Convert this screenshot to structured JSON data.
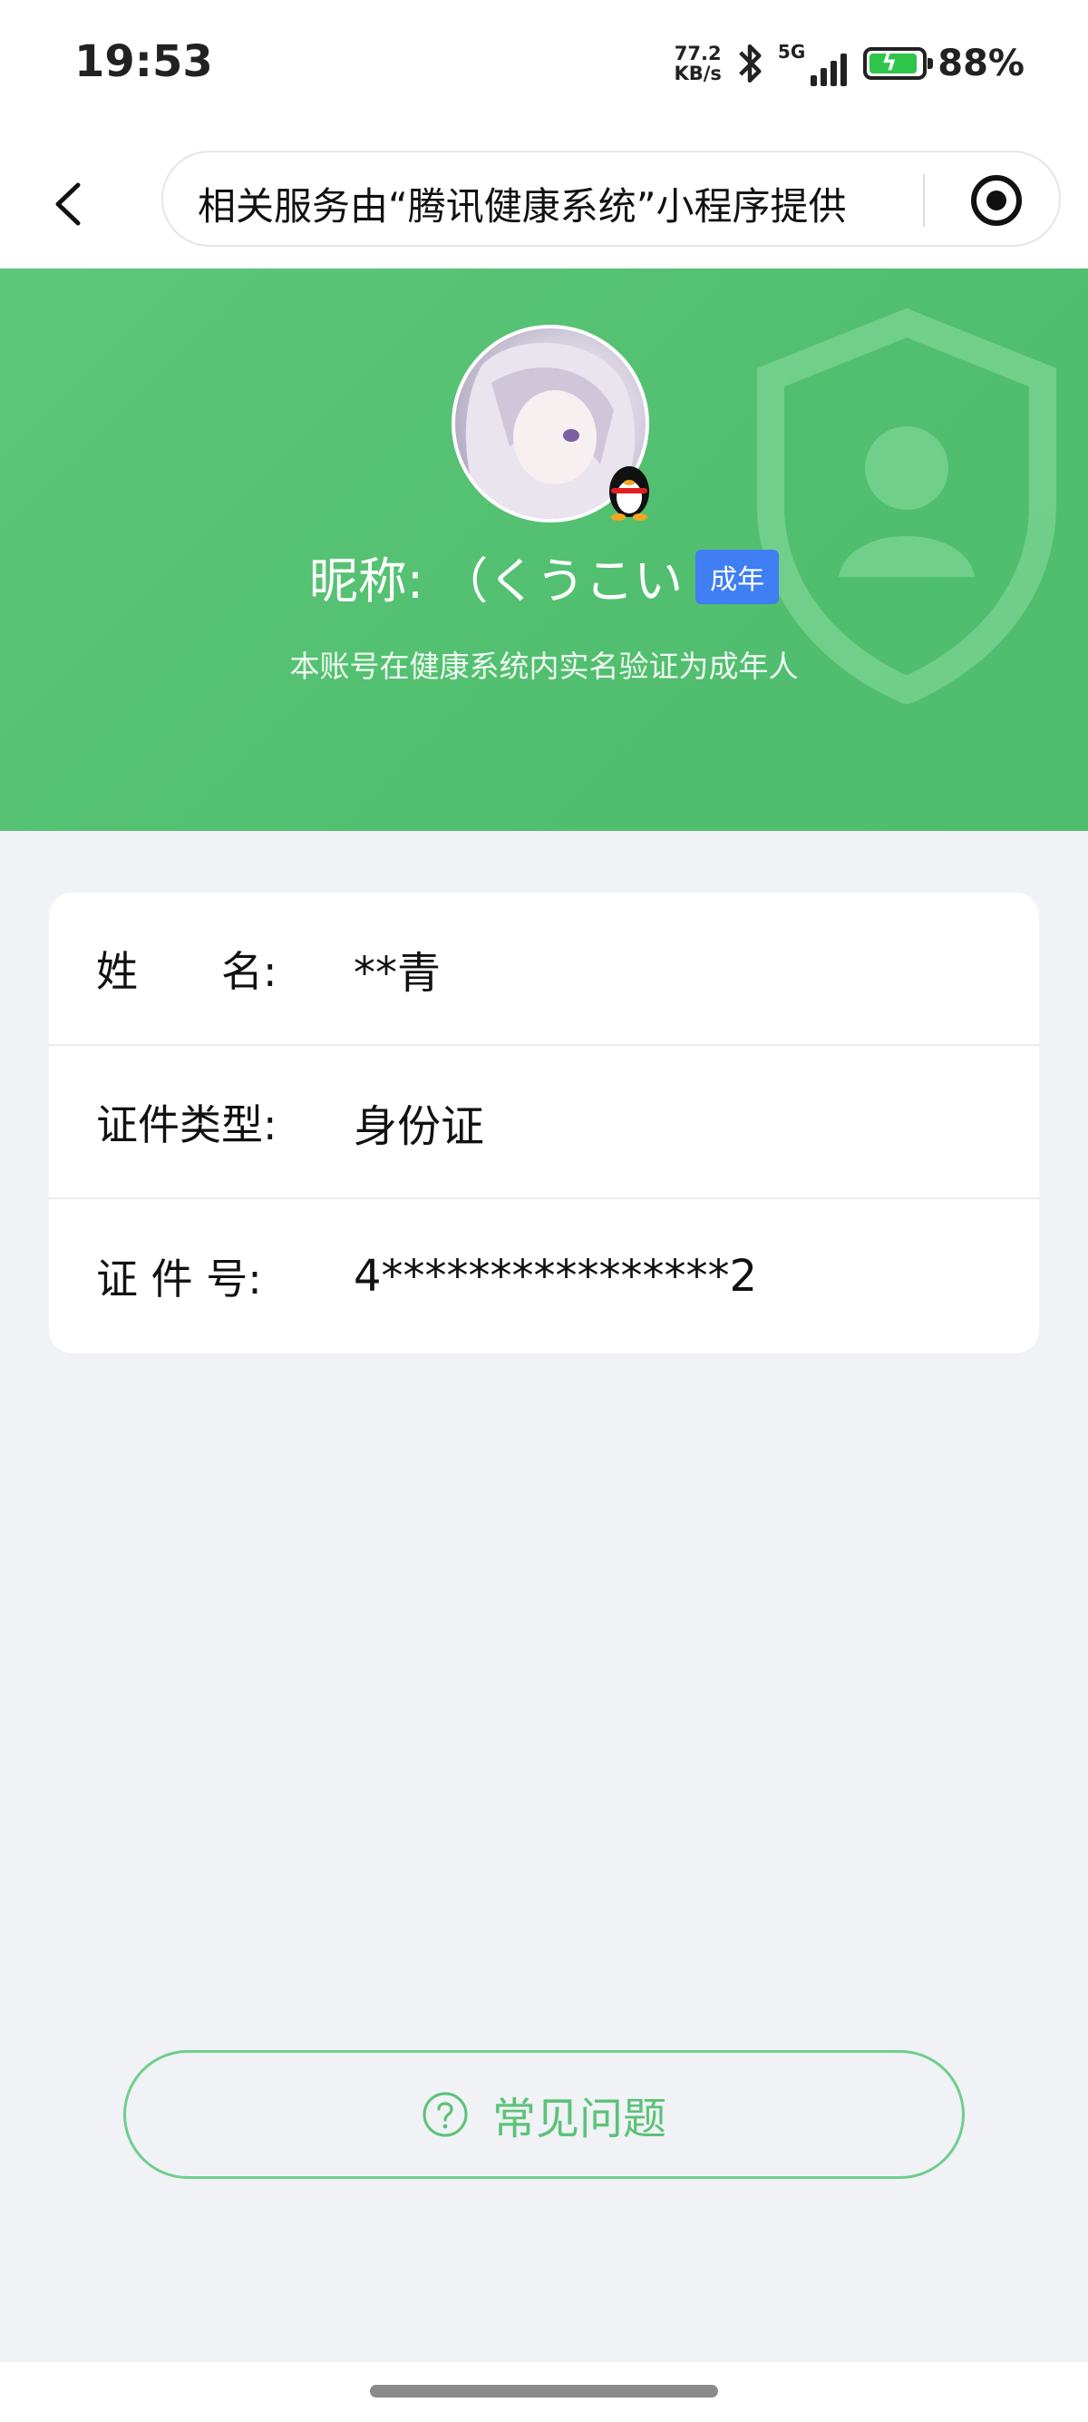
{
  "status_bar": {
    "time": "19:53",
    "net_speed_value": "77.2",
    "net_speed_unit": "KB/s",
    "signal_label": "5G",
    "battery_percent": "88%",
    "battery_level": 0.88,
    "battery_color": "#2fc44a"
  },
  "nav": {
    "back_icon": "chevron-left-icon",
    "capsule_text": "相关服务由“腾讯健康系统”小程序提供",
    "capsule_icon": "target-icon"
  },
  "profile": {
    "avatar_icon": "avatar-image",
    "badge_icon": "qq-penguin-icon",
    "nickname": "昵称: （くうこい",
    "tag": "成年",
    "tag_color": "#3f7ef3",
    "verify_text": "本账号在健康系统内实名验证为成年人",
    "header_color": "#5cc477"
  },
  "info": {
    "rows": [
      {
        "label": "姓　　名:",
        "value": "**青"
      },
      {
        "label": "证件类型:",
        "value": "身份证"
      },
      {
        "label": "证 件 号:",
        "value": "4****************2"
      }
    ]
  },
  "faq": {
    "icon": "question-circle-icon",
    "label": "常见问题",
    "color": "#5cc278"
  }
}
